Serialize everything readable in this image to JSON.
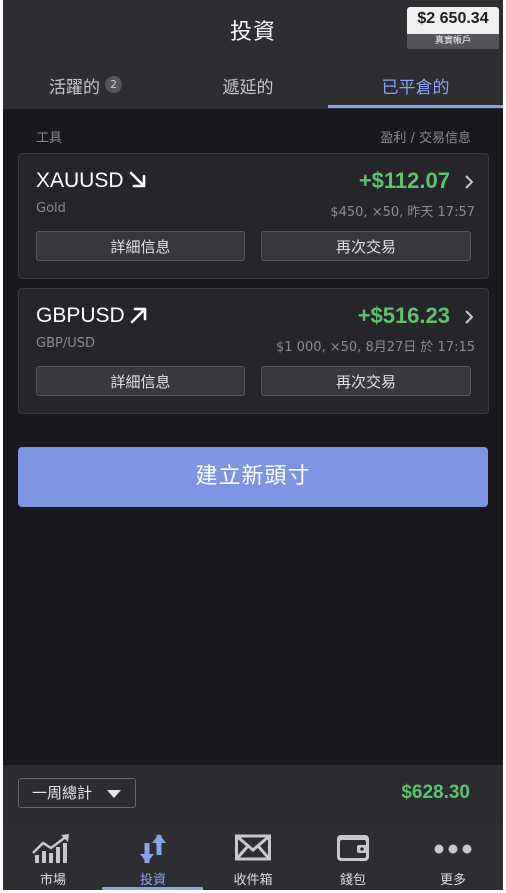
{
  "header": {
    "title": "投資",
    "balance": {
      "amount": "$2 650.34",
      "label": "真實帳戶"
    }
  },
  "tabs": [
    {
      "label": "活躍的",
      "badge": "2",
      "active": false
    },
    {
      "label": "遞延的",
      "active": false
    },
    {
      "label": "已平倉的",
      "active": true
    }
  ],
  "columns": {
    "left": "工具",
    "right": "盈利 / 交易信息"
  },
  "positions": [
    {
      "symbol": "XAUUSD",
      "direction": "down",
      "pnl": "+$112.07",
      "name": "Gold",
      "info": "$450, ×50, 昨天 17:57",
      "details_label": "詳細信息",
      "trade_again_label": "再次交易"
    },
    {
      "symbol": "GBPUSD",
      "direction": "up",
      "pnl": "+$516.23",
      "name": "GBP/USD",
      "info": "$1 000, ×50, 8月27日 於 17:15",
      "details_label": "詳細信息",
      "trade_again_label": "再次交易"
    }
  ],
  "new_position_label": "建立新頭寸",
  "summary": {
    "period": "一周總計",
    "total": "$628.30"
  },
  "nav": [
    {
      "label": "市場",
      "icon": "chart-icon",
      "active": false
    },
    {
      "label": "投資",
      "icon": "transfer-arrows-icon",
      "active": true
    },
    {
      "label": "收件箱",
      "icon": "envelope-icon",
      "active": false
    },
    {
      "label": "錢包",
      "icon": "wallet-icon",
      "active": false
    },
    {
      "label": "更多",
      "icon": "more-icon",
      "active": false
    }
  ],
  "colors": {
    "accent": "#8aa3ef",
    "profit": "#5cc46f",
    "background": "#1a181c",
    "button": "#7b95e3"
  }
}
